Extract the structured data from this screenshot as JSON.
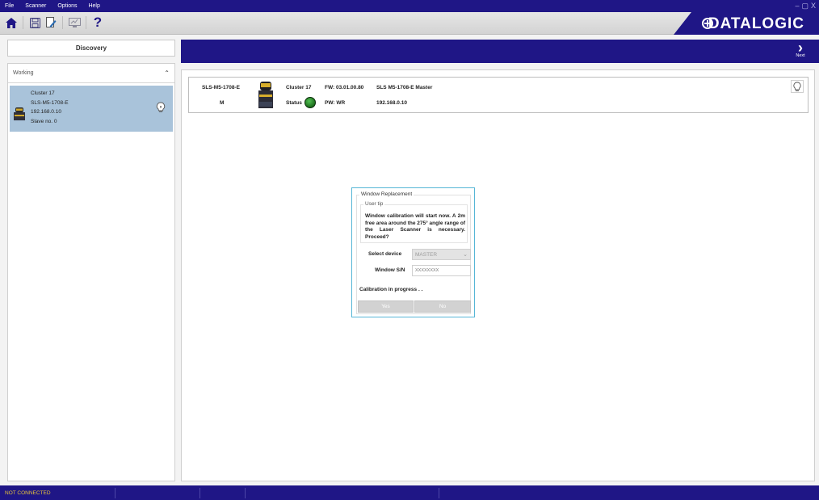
{
  "menu": [
    "File",
    "Scanner",
    "Options",
    "Help"
  ],
  "window_controls": {
    "minimize": "–",
    "restore": "▢",
    "close": "X"
  },
  "toolbar": {
    "help_glyph": "?"
  },
  "brand": {
    "logo": "DATALOGIC"
  },
  "left": {
    "discovery_label": "Discovery",
    "working_label": "Working",
    "collapse_glyph": "⌃",
    "device": {
      "cluster": "Cluster 17",
      "model": "SLS-M5-1708-E",
      "ip": "192.168.0.10",
      "slave": "Slave no.   0"
    }
  },
  "next": {
    "label": "Next",
    "glyph": "›"
  },
  "scanner": {
    "model": "SLS-M5-1708-E",
    "mode": "M",
    "cluster": "Cluster 17",
    "status_label": "Status",
    "fw": "FW: 03.01.00.80",
    "pw": "PW: WR",
    "name": "SLS M5-1708-E Master",
    "ip": "192.168.0.10"
  },
  "dialog": {
    "title": "Window Replacement",
    "tip_title": "User tip",
    "tip_text": "Window calibration will start now. A 2m free area around the 275° angle range of the Laser Scanner is necessary. Proceed?",
    "select_device_label": "Select device",
    "select_device_value": "MASTER",
    "window_sn_label": "Window S/N",
    "window_sn_placeholder": "XXXXXXXX",
    "calibration_text": "Calibration in progress  . .",
    "yes": "Yes",
    "no": "No"
  },
  "status": {
    "connection": "NOT CONNECTED"
  },
  "colors": {
    "navy": "#1f1686",
    "selection": "#a9c3da",
    "status_text": "#e8c43a",
    "dialog_border": "#56b6d6"
  }
}
